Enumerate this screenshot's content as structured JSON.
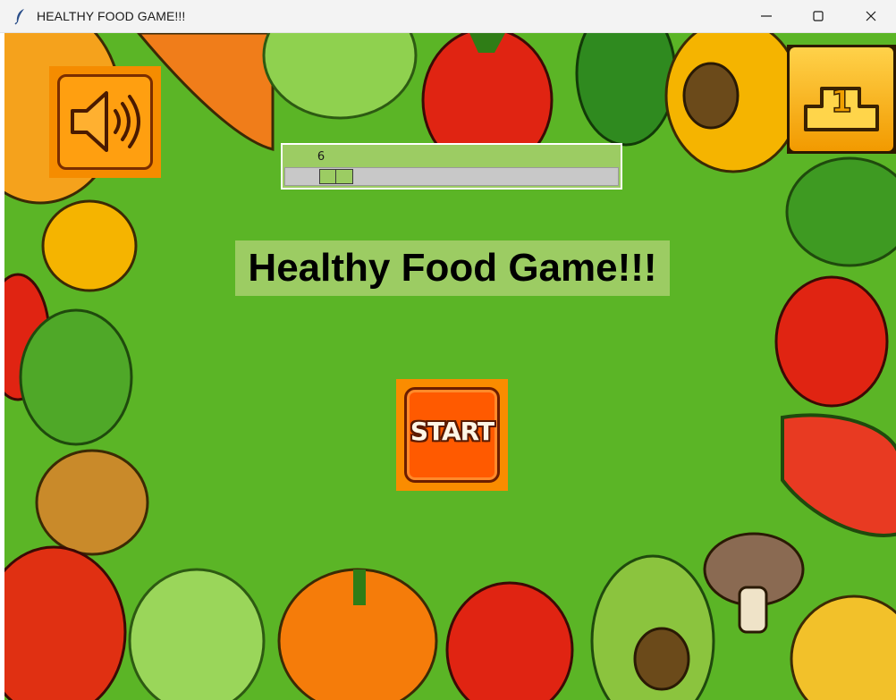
{
  "window": {
    "title": "HEALTHY FOOD GAME!!!",
    "icon": "feather-icon",
    "controls": [
      "minimize-icon",
      "maximize-icon",
      "close-icon"
    ]
  },
  "game": {
    "title": "Healthy Food Game!!!",
    "start_label": "START",
    "leaderboard_rank": "1",
    "sound_icon": "speaker-icon",
    "leaderboard_icon": "podium-icon"
  },
  "slider": {
    "value": "6",
    "fraction": 0.06
  },
  "colors": {
    "background_green": "#5bb526",
    "panel_green": "#9ccc63",
    "orange": "#f58c00",
    "start_orange": "#ff5a00"
  }
}
